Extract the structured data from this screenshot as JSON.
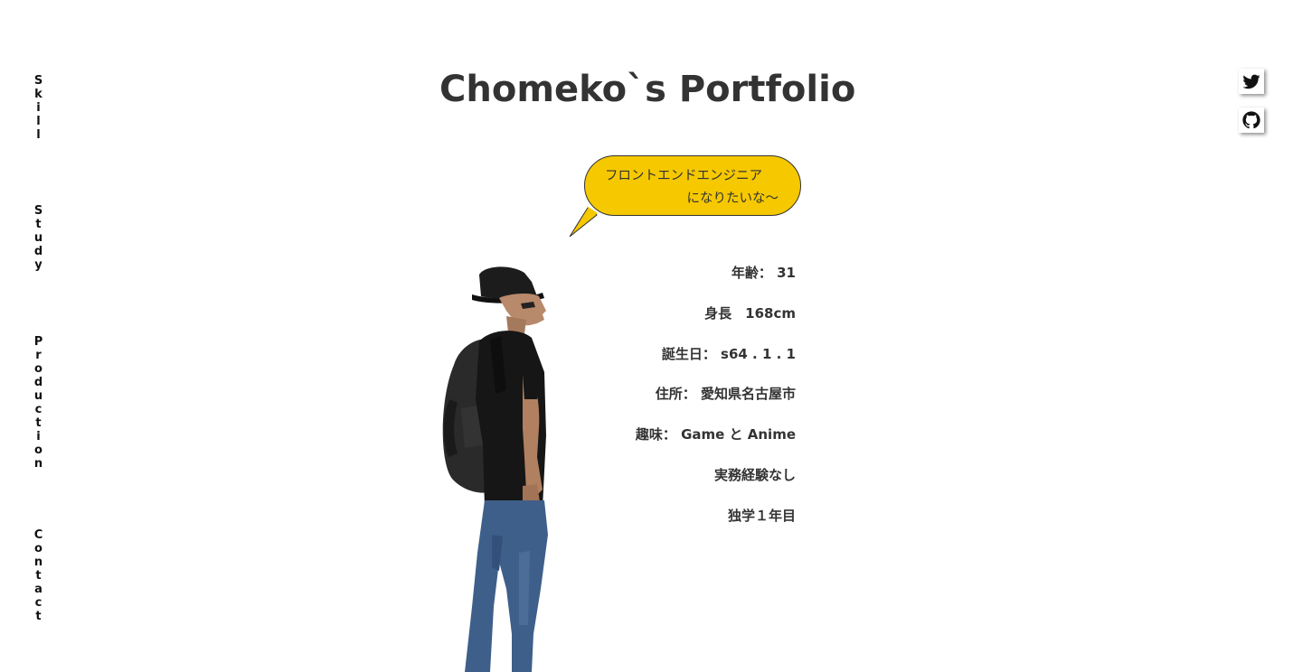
{
  "nav": {
    "items": [
      {
        "label": "Skill"
      },
      {
        "label": "Study"
      },
      {
        "label": "Production"
      },
      {
        "label": "Contact"
      }
    ]
  },
  "social": {
    "items": [
      {
        "icon": "twitter-icon"
      },
      {
        "icon": "github-icon"
      }
    ]
  },
  "header": {
    "title": "Chomeko`s Portfolio"
  },
  "bubble": {
    "line1": "フロントエンドエンジニア",
    "line2": "になりたいな〜",
    "color": "#f5c800"
  },
  "profile": {
    "items": [
      "年齢： 31",
      "身長　168cm",
      "誕生日： s64 . 1 . 1",
      "住所： 愛知県名古屋市",
      "趣味： Game と Anime",
      "実務経験なし",
      "独学１年目"
    ]
  }
}
